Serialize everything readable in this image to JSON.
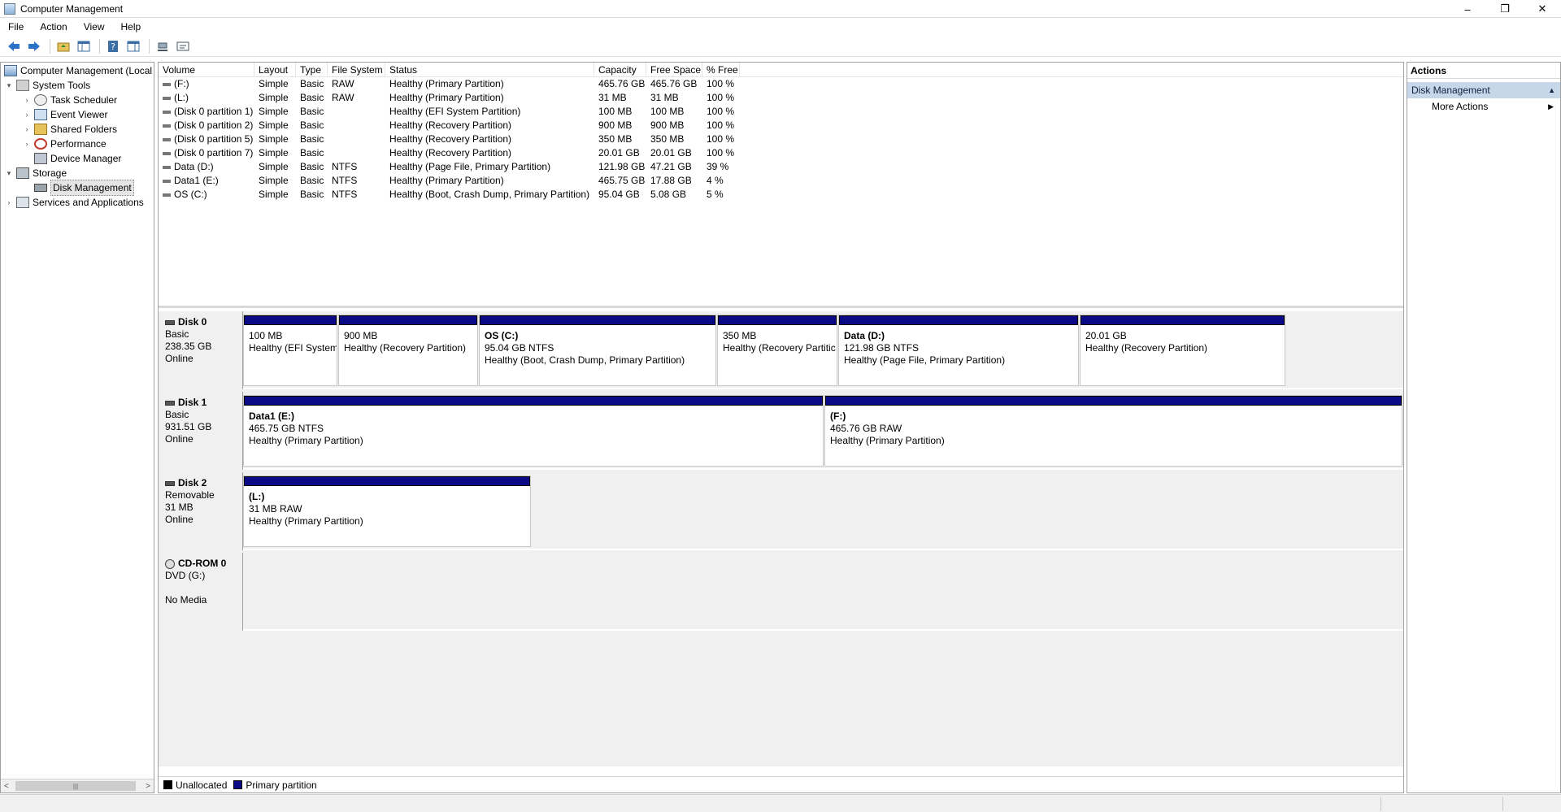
{
  "window": {
    "title": "Computer Management",
    "controls": {
      "minimize": "–",
      "restore": "❐",
      "close": "✕"
    }
  },
  "menu": [
    "File",
    "Action",
    "View",
    "Help"
  ],
  "toolbar_icons": [
    "back-icon",
    "forward-icon",
    "up-folder-icon",
    "show-hide-tree-icon",
    "help-icon",
    "show-hide-action-pane-icon",
    "connect-icon",
    "properties-icon"
  ],
  "tree": [
    {
      "label": "Computer Management (Local",
      "expander": "",
      "icon": "computer-icon",
      "indent": 0
    },
    {
      "label": "System Tools",
      "expander": "▾",
      "icon": "tools-icon",
      "indent": 1
    },
    {
      "label": "Task Scheduler",
      "expander": "›",
      "icon": "clock-icon",
      "indent": 2
    },
    {
      "label": "Event Viewer",
      "expander": "›",
      "icon": "event-viewer-icon",
      "indent": 2
    },
    {
      "label": "Shared Folders",
      "expander": "›",
      "icon": "shared-folder-icon",
      "indent": 2
    },
    {
      "label": "Performance",
      "expander": "›",
      "icon": "performance-icon",
      "indent": 2
    },
    {
      "label": "Device Manager",
      "expander": "",
      "icon": "device-manager-icon",
      "indent": 2
    },
    {
      "label": "Storage",
      "expander": "▾",
      "icon": "storage-icon",
      "indent": 1
    },
    {
      "label": "Disk Management",
      "expander": "",
      "icon": "disk-management-icon",
      "indent": 2,
      "selected": true
    },
    {
      "label": "Services and Applications",
      "expander": "›",
      "icon": "services-icon",
      "indent": 1
    }
  ],
  "volume_table": {
    "headers": [
      "Volume",
      "Layout",
      "Type",
      "File System",
      "Status",
      "Capacity",
      "Free Space",
      "% Free"
    ],
    "rows": [
      [
        "(F:)",
        "Simple",
        "Basic",
        "RAW",
        "Healthy (Primary Partition)",
        "465.76 GB",
        "465.76 GB",
        "100 %"
      ],
      [
        "(L:)",
        "Simple",
        "Basic",
        "RAW",
        "Healthy (Primary Partition)",
        "31 MB",
        "31 MB",
        "100 %"
      ],
      [
        "(Disk 0 partition 1)",
        "Simple",
        "Basic",
        "",
        "Healthy (EFI System Partition)",
        "100 MB",
        "100 MB",
        "100 %"
      ],
      [
        "(Disk 0 partition 2)",
        "Simple",
        "Basic",
        "",
        "Healthy (Recovery Partition)",
        "900 MB",
        "900 MB",
        "100 %"
      ],
      [
        "(Disk 0 partition 5)",
        "Simple",
        "Basic",
        "",
        "Healthy (Recovery Partition)",
        "350 MB",
        "350 MB",
        "100 %"
      ],
      [
        "(Disk 0 partition 7)",
        "Simple",
        "Basic",
        "",
        "Healthy (Recovery Partition)",
        "20.01 GB",
        "20.01 GB",
        "100 %"
      ],
      [
        "Data (D:)",
        "Simple",
        "Basic",
        "NTFS",
        "Healthy (Page File, Primary Partition)",
        "121.98 GB",
        "47.21 GB",
        "39 %"
      ],
      [
        "Data1 (E:)",
        "Simple",
        "Basic",
        "NTFS",
        "Healthy (Primary Partition)",
        "465.75 GB",
        "17.88 GB",
        "4 %"
      ],
      [
        "OS (C:)",
        "Simple",
        "Basic",
        "NTFS",
        "Healthy (Boot, Crash Dump, Primary Partition)",
        "95.04 GB",
        "5.08 GB",
        "5 %"
      ]
    ]
  },
  "disks": [
    {
      "name": "Disk 0",
      "type": "Basic",
      "size": "238.35 GB",
      "status": "Online",
      "partitions": [
        {
          "name": "",
          "size": "100 MB",
          "status": "Healthy (EFI System"
        },
        {
          "name": "",
          "size": "900 MB",
          "status": "Healthy (Recovery Partition)"
        },
        {
          "name": "OS  (C:)",
          "size": "95.04 GB NTFS",
          "status": "Healthy (Boot, Crash Dump, Primary Partition)"
        },
        {
          "name": "",
          "size": "350 MB",
          "status": "Healthy (Recovery Partitic"
        },
        {
          "name": "Data  (D:)",
          "size": "121.98 GB NTFS",
          "status": "Healthy (Page File, Primary Partition)"
        },
        {
          "name": "",
          "size": "20.01 GB",
          "status": "Healthy (Recovery Partition)"
        }
      ]
    },
    {
      "name": "Disk 1",
      "type": "Basic",
      "size": "931.51 GB",
      "status": "Online",
      "partitions": [
        {
          "name": "Data1  (E:)",
          "size": "465.75 GB NTFS",
          "status": "Healthy (Primary Partition)"
        },
        {
          "name": "(F:)",
          "size": "465.76 GB RAW",
          "status": "Healthy (Primary Partition)"
        }
      ]
    },
    {
      "name": "Disk 2",
      "type": "Removable",
      "size": "31 MB",
      "status": "Online",
      "partitions": [
        {
          "name": "(L:)",
          "size": "31 MB RAW",
          "status": "Healthy (Primary Partition)"
        }
      ]
    },
    {
      "name": "CD-ROM 0",
      "type": "DVD (G:)",
      "size": "",
      "status": "No Media",
      "partitions": []
    }
  ],
  "legend": [
    {
      "label": "Unallocated",
      "color": "#000000"
    },
    {
      "label": "Primary partition",
      "color": "#0a0a86"
    }
  ],
  "actions": {
    "title": "Actions",
    "section": "Disk Management",
    "items": [
      "More Actions"
    ]
  },
  "colors": {
    "partition_bar": "#0a0a86",
    "actions_section": "#c7d7ea"
  }
}
